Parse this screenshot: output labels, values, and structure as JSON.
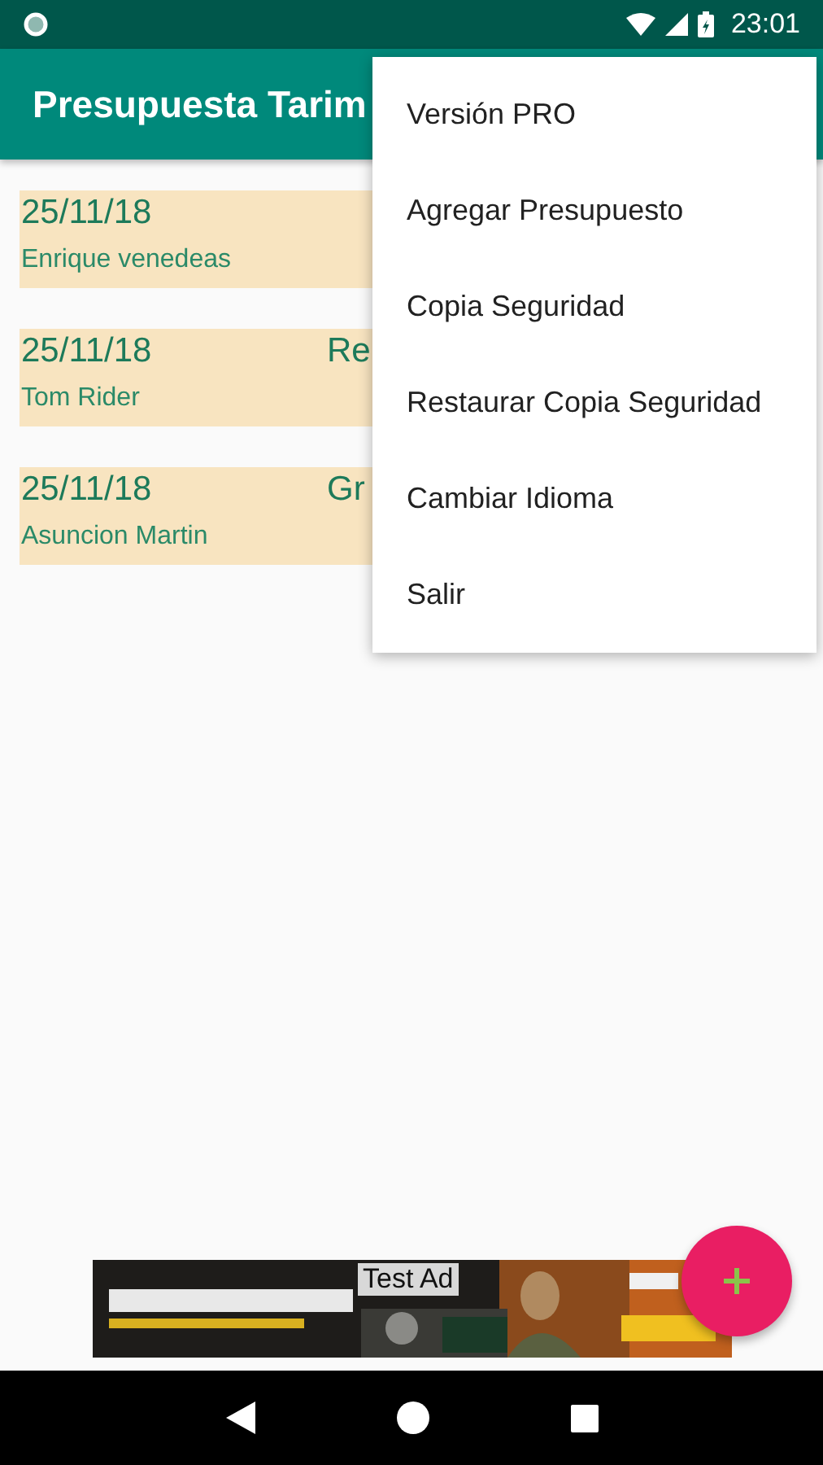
{
  "status_bar": {
    "time": "23:01"
  },
  "app_bar": {
    "title": "Presupuesta Tarim"
  },
  "budgets": [
    {
      "date": "25/11/18",
      "client": "Enrique venedeas"
    },
    {
      "date": "25/11/18",
      "client": "Tom Rider",
      "column_2": "Re"
    },
    {
      "date": "25/11/18",
      "client": "Asuncion Martin",
      "column_2": "Gr"
    }
  ],
  "overflow_menu": [
    "Versión PRO",
    "Agregar Presupuesto",
    "Copia Seguridad",
    "Restaurar Copia Seguridad",
    "Cambiar Idioma",
    "Salir"
  ],
  "ad_banner": {
    "kind": "picture",
    "label": "Test Ad"
  }
}
